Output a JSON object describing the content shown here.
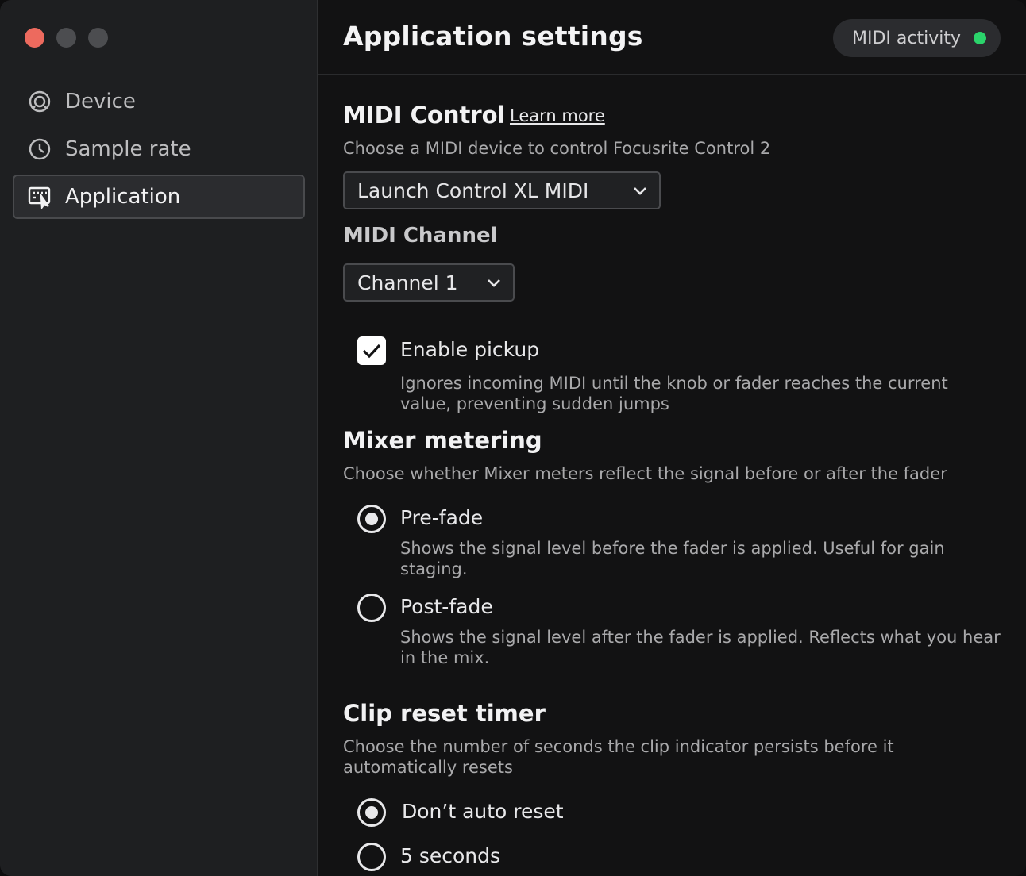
{
  "sidebar": {
    "items": [
      {
        "label": "Device",
        "icon": "device-icon",
        "active": false
      },
      {
        "label": "Sample rate",
        "icon": "clock-icon",
        "active": false
      },
      {
        "label": "Application",
        "icon": "application-icon",
        "active": true
      }
    ]
  },
  "header": {
    "title": "Application settings",
    "midi_activity_label": "MIDI activity",
    "midi_activity_color": "#2bd46b"
  },
  "midi_control": {
    "title": "MIDI Control",
    "learn_more": "Learn more",
    "description": "Choose a MIDI device to control Focusrite Control 2",
    "device_value": "Launch Control XL MIDI",
    "channel_title": "MIDI Channel",
    "channel_value": "Channel 1",
    "pickup_label": "Enable pickup",
    "pickup_checked": true,
    "pickup_description": "Ignores incoming MIDI until the knob or fader reaches the current value, preventing sudden jumps"
  },
  "mixer_metering": {
    "title": "Mixer metering",
    "description": "Choose whether Mixer meters reflect the signal before or after the fader",
    "options": [
      {
        "label": "Pre-fade",
        "selected": true,
        "description": "Shows the signal level before the fader is applied. Useful for gain staging."
      },
      {
        "label": "Post-fade",
        "selected": false,
        "description": "Shows the signal level after the fader is applied. Reflects what you hear in the mix."
      }
    ]
  },
  "clip_reset": {
    "title": "Clip reset timer",
    "description": "Choose the number of seconds the clip indicator persists before it automatically resets",
    "options": [
      {
        "label": "Don’t auto reset",
        "selected": true
      },
      {
        "label": "5 seconds",
        "selected": false
      }
    ]
  }
}
